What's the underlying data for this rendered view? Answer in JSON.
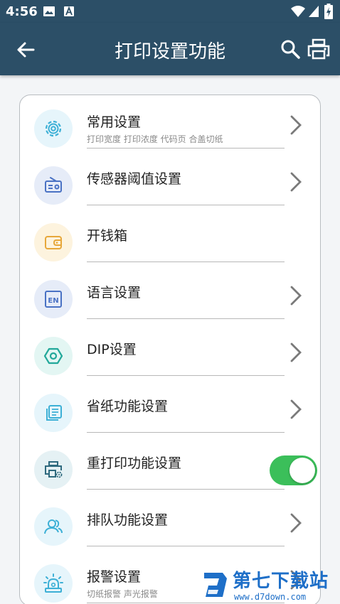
{
  "status": {
    "time": "4:56",
    "icons": [
      "image-icon",
      "a-notify-icon",
      "wifi-icon",
      "cell-signal-icon",
      "battery-charging-icon"
    ]
  },
  "appbar": {
    "title": "打印设置功能",
    "bg_color": "#2c4f67",
    "icons": [
      "back-arrow-icon",
      "search-icon",
      "printer-icon"
    ]
  },
  "items": [
    {
      "title": "常用设置",
      "subtitle": "打印宽度 打印浓度 代码页 合盖切纸",
      "icon": "gear-icon",
      "icon_bg": "#e6f5fb",
      "icon_color": "#3db0d6",
      "trailing": "chevron"
    },
    {
      "title": "传感器阈值设置",
      "subtitle": "",
      "icon": "radio-sensor-icon",
      "icon_bg": "#e6ecf8",
      "icon_color": "#4a72c4",
      "trailing": "chevron"
    },
    {
      "title": "开钱箱",
      "subtitle": "",
      "icon": "wallet-icon",
      "icon_bg": "#fdf3de",
      "icon_color": "#e7a73a",
      "trailing": "none"
    },
    {
      "title": "语言设置",
      "subtitle": "",
      "icon": "en-language-icon",
      "icon_bg": "#e6ecf8",
      "icon_color": "#4a72c4",
      "trailing": "chevron"
    },
    {
      "title": "DIP设置",
      "subtitle": "",
      "icon": "hex-nut-icon",
      "icon_bg": "#e3f6f3",
      "icon_color": "#22a89a",
      "trailing": "chevron"
    },
    {
      "title": "省纸功能设置",
      "subtitle": "",
      "icon": "paper-stack-icon",
      "icon_bg": "#e6f5fb",
      "icon_color": "#3db0d6",
      "trailing": "chevron"
    },
    {
      "title": "重打印功能设置",
      "subtitle": "",
      "icon": "printer-gear-icon",
      "icon_bg": "#e5f1f4",
      "icon_color": "#2f6a7e",
      "trailing": "toggle",
      "toggle_on": true,
      "toggle_color": "#3bbf5a"
    },
    {
      "title": "排队功能设置",
      "subtitle": "",
      "icon": "users-icon",
      "icon_bg": "#e6f5fb",
      "icon_color": "#3db0d6",
      "trailing": "chevron"
    },
    {
      "title": "报警设置",
      "subtitle": "切纸报警 声光报警",
      "icon": "alarm-light-icon",
      "icon_bg": "#e6f5fb",
      "icon_color": "#3db0d6",
      "trailing": "chevron"
    }
  ],
  "watermark": {
    "name": "第七下载站",
    "url": "www.d7down.com",
    "color": "#1e6fc8"
  }
}
